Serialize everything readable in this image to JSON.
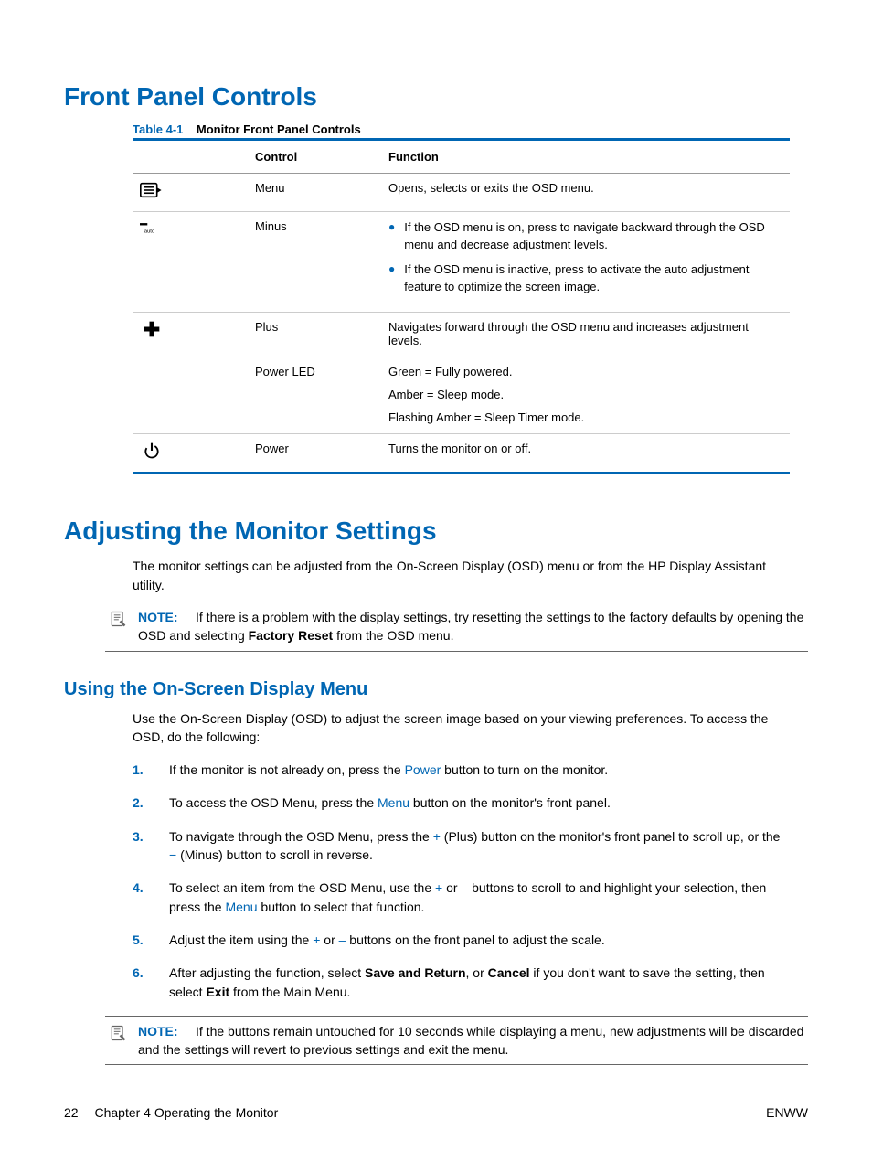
{
  "h1_front_panel": "Front Panel Controls",
  "table": {
    "caption_prefix": "Table 4-1",
    "caption_title": "Monitor Front Panel Controls",
    "head_control": "Control",
    "head_function": "Function",
    "rows": [
      {
        "control": "Menu",
        "functions": [
          "Opens, selects or exits the OSD menu."
        ]
      },
      {
        "control": "Minus",
        "functions": [
          "If the OSD menu is on, press to navigate backward through the OSD menu and decrease adjustment levels.",
          "If the OSD menu is inactive, press to activate the auto adjustment feature to optimize the screen image."
        ]
      },
      {
        "control": "Plus",
        "functions": [
          "Navigates forward through the OSD menu and increases adjustment levels."
        ]
      },
      {
        "control": "Power LED",
        "functions": [
          "Green = Fully powered.",
          "Amber = Sleep mode.",
          "Flashing Amber = Sleep Timer mode."
        ]
      },
      {
        "control": "Power",
        "functions": [
          "Turns the monitor on or off."
        ]
      }
    ]
  },
  "h1_adjusting": "Adjusting the Monitor Settings",
  "para_intro": "The monitor settings can be adjusted from the On-Screen Display (OSD) menu or from the HP Display Assistant utility.",
  "note1": {
    "label": "NOTE:",
    "body_before": "If there is a problem with the display settings, try resetting the settings to the factory defaults by opening the OSD and selecting ",
    "bold": "Factory Reset",
    "body_after": " from the OSD menu."
  },
  "h2_osd": "Using the On-Screen Display Menu",
  "osd_intro": "Use the On-Screen Display (OSD) to adjust the screen image based on your viewing preferences. To access the OSD, do the following:",
  "steps": {
    "s1": {
      "a": "If the monitor is not already on, press the ",
      "k1": "Power",
      "b": " button to turn on the monitor."
    },
    "s2": {
      "a": "To access the OSD Menu, press the ",
      "k1": "Menu",
      "b": " button on the monitor's front panel."
    },
    "s3": {
      "a": "To navigate through the OSD Menu, press the ",
      "k1": "+",
      "b": " (Plus) button on the monitor's front panel to scroll up, or the ",
      "k2": "−",
      "c": " (Minus) button to scroll in reverse."
    },
    "s4": {
      "a": "To select an item from the OSD Menu, use the ",
      "k1": "+",
      "b": " or ",
      "k2": "–",
      "c": " buttons to scroll to and highlight your selection, then press the ",
      "k3": "Menu",
      "d": " button to select that function."
    },
    "s5": {
      "a": "Adjust the item using the ",
      "k1": "+",
      "b": " or ",
      "k2": "–",
      "c": " buttons on the front panel to adjust the scale."
    },
    "s6": {
      "a": "After adjusting the function, select ",
      "b1": "Save and Return",
      "b": ", or ",
      "b2": "Cancel",
      "c": " if you don't want to save the setting, then select ",
      "b3": "Exit",
      "d": " from the Main Menu."
    }
  },
  "note2": {
    "label": "NOTE:",
    "body": "If the buttons remain untouched for 10 seconds while displaying a menu, new adjustments will be discarded and the settings will revert to previous settings and exit the menu."
  },
  "footer": {
    "page": "22",
    "chapter": "Chapter 4   Operating the Monitor",
    "right": "ENWW"
  }
}
